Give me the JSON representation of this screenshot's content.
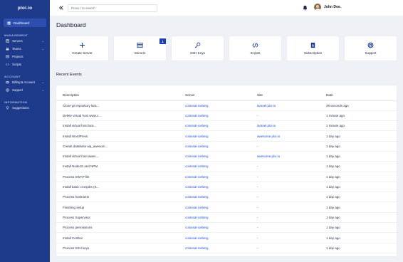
{
  "brand": "ploi.io",
  "sidebar": {
    "active": {
      "label": "Dashboard",
      "icon": "dashboard-icon"
    },
    "sections": [
      {
        "title": "MANAGEMENT",
        "items": [
          {
            "label": "Servers",
            "icon": "server-icon",
            "chevron": "⌄"
          },
          {
            "label": "Teams",
            "icon": "users-icon",
            "chevron": "⌄"
          },
          {
            "label": "Projects",
            "icon": "projects-icon"
          },
          {
            "label": "Scripts",
            "icon": "scripts-icon"
          }
        ]
      },
      {
        "title": "ACCOUNT",
        "items": [
          {
            "label": "Billing & Account",
            "icon": "billing-icon",
            "chevron": "⌄"
          },
          {
            "label": "Support",
            "icon": "support-icon",
            "chevron": "⌄"
          }
        ]
      },
      {
        "title": "INFORMATION",
        "items": [
          {
            "label": "Suggestions",
            "icon": "suggestions-icon"
          }
        ]
      }
    ]
  },
  "topbar": {
    "search_placeholder": "Press / to search",
    "user_name": "John Doe",
    "chevron": "⌄"
  },
  "page_title": "Dashboard",
  "cards": [
    {
      "label": "Create Server",
      "icon": "plus-icon"
    },
    {
      "label": "Servers",
      "icon": "servers-list-icon",
      "badge": "1"
    },
    {
      "label": "SSH Keys",
      "icon": "key-icon"
    },
    {
      "label": "Scripts",
      "icon": "code-icon"
    },
    {
      "label": "Subscription",
      "icon": "subscription-icon"
    },
    {
      "label": "Support",
      "icon": "lifebuoy-icon"
    }
  ],
  "recent_events": {
    "title": "Recent Events",
    "columns": [
      "Description",
      "Server",
      "Site",
      "Date"
    ],
    "rows": [
      {
        "description": "Clone git repository lara...",
        "server": "colossal-iceberg",
        "site": "laravel.ploi.io",
        "date": "28 seconds ago"
      },
      {
        "description": "Delete virtual host www.c...",
        "server": "colossal-iceberg",
        "site": "-",
        "date": "1 minute ago"
      },
      {
        "description": "Install virtual host lara...",
        "server": "colossal-iceberg",
        "site": "laravel.ploi.io",
        "date": "1 minute ago"
      },
      {
        "description": "Install WordPress",
        "server": "colossal-iceberg",
        "site": "awesome.ploi.io",
        "date": "1 day ago"
      },
      {
        "description": "Create database wp_awesom...",
        "server": "colossal-iceberg",
        "site": "-",
        "date": "1 day ago"
      },
      {
        "description": "Install virtual host awes...",
        "server": "colossal-iceberg",
        "site": "awesome.ploi.io",
        "date": "1 day ago"
      },
      {
        "description": "Install NodeJS and NPM",
        "server": "colossal-iceberg",
        "site": "-",
        "date": "1 day ago"
      },
      {
        "description": "Process SWAP file",
        "server": "colossal-iceberg",
        "site": "-",
        "date": "1 day ago"
      },
      {
        "description": "Install basic cronjobs (S...",
        "server": "colossal-iceberg",
        "site": "-",
        "date": "1 day ago"
      },
      {
        "description": "Process hostname",
        "server": "colossal-iceberg",
        "site": "-",
        "date": "1 day ago"
      },
      {
        "description": "Finishing setup",
        "server": "colossal-iceberg",
        "site": "-",
        "date": "1 day ago"
      },
      {
        "description": "Process Supervisor",
        "server": "colossal-iceberg",
        "site": "-",
        "date": "1 day ago"
      },
      {
        "description": "Process permissions",
        "server": "colossal-iceberg",
        "site": "-",
        "date": "1 day ago"
      },
      {
        "description": "Install Certbot",
        "server": "colossal-iceberg",
        "site": "-",
        "date": "1 day ago"
      },
      {
        "description": "Process SSH keys",
        "server": "colossal-iceberg",
        "site": "-",
        "date": "1 day ago"
      }
    ]
  },
  "colors": {
    "sidebar": "#1e3a8a",
    "accent": "#1d4ed8",
    "background": "#eef1f6"
  }
}
